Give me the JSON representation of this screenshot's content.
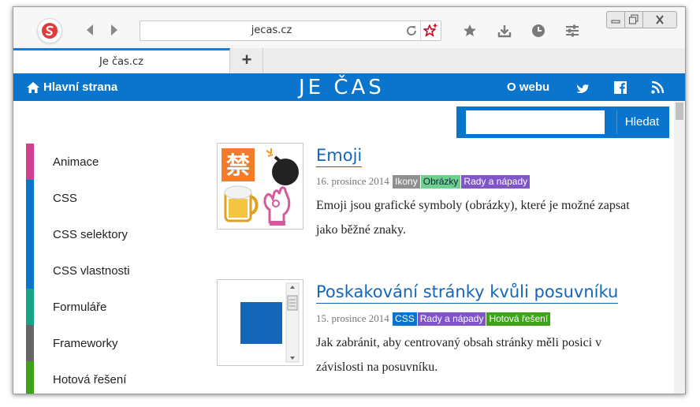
{
  "browser": {
    "url": "jecas.cz",
    "tab_title": "Je čas.cz",
    "new_tab_label": "+"
  },
  "header": {
    "home_label": "Hlavní strana",
    "brand": "JE ČAS",
    "about_label": "O webu"
  },
  "search": {
    "value": "",
    "placeholder": "",
    "button_label": "Hledat"
  },
  "sidebar": {
    "items": [
      {
        "label": "Animace",
        "color": "#d0408f"
      },
      {
        "label": "CSS",
        "color": "#0b74cc"
      },
      {
        "label": "CSS selektory",
        "color": "#0b74cc"
      },
      {
        "label": "CSS vlastnosti",
        "color": "#0b74cc"
      },
      {
        "label": "Formuláře",
        "color": "#17a589"
      },
      {
        "label": "Frameworky",
        "color": "#666666"
      },
      {
        "label": "Hotová řešení",
        "color": "#3ea31a"
      }
    ]
  },
  "articles": [
    {
      "title": "Emoji",
      "date": "16. prosince 2014",
      "tags": [
        {
          "label": "Ikony",
          "color": "#8f8f8f"
        },
        {
          "label": "Obrázky",
          "color": "#6dd08f"
        },
        {
          "label": "Rady a nápady",
          "color": "#8055c8"
        }
      ],
      "excerpt_line1": "Emoji jsou grafické symboly (obrázky), které je možné zapsat",
      "excerpt_line2": "jako běžné znaky."
    },
    {
      "title": "Poskakování stránky kvůli posuvníku",
      "date": "15. prosince 2014",
      "tags": [
        {
          "label": "CSS",
          "color": "#0b74cc"
        },
        {
          "label": "Rady a nápady",
          "color": "#8055c8"
        },
        {
          "label": "Hotová řešení",
          "color": "#3ea31a"
        }
      ],
      "excerpt_line1": "Jak zabránit, aby centrovaný obsah stránky měli posici v",
      "excerpt_line2": "závislosti na posuvníku."
    }
  ],
  "icons": {
    "back": "back-arrow-icon",
    "forward": "forward-arrow-icon",
    "reload": "reload-icon",
    "add_bookmark": "star-plus-icon",
    "bookmarks": "star-icon",
    "downloads": "download-icon",
    "history": "clock-icon",
    "settings": "sliders-icon",
    "home": "home-icon",
    "twitter": "twitter-icon",
    "facebook": "facebook-icon",
    "rss": "rss-icon"
  },
  "colors": {
    "accent": "#0b74cc",
    "link": "#1467b8"
  }
}
